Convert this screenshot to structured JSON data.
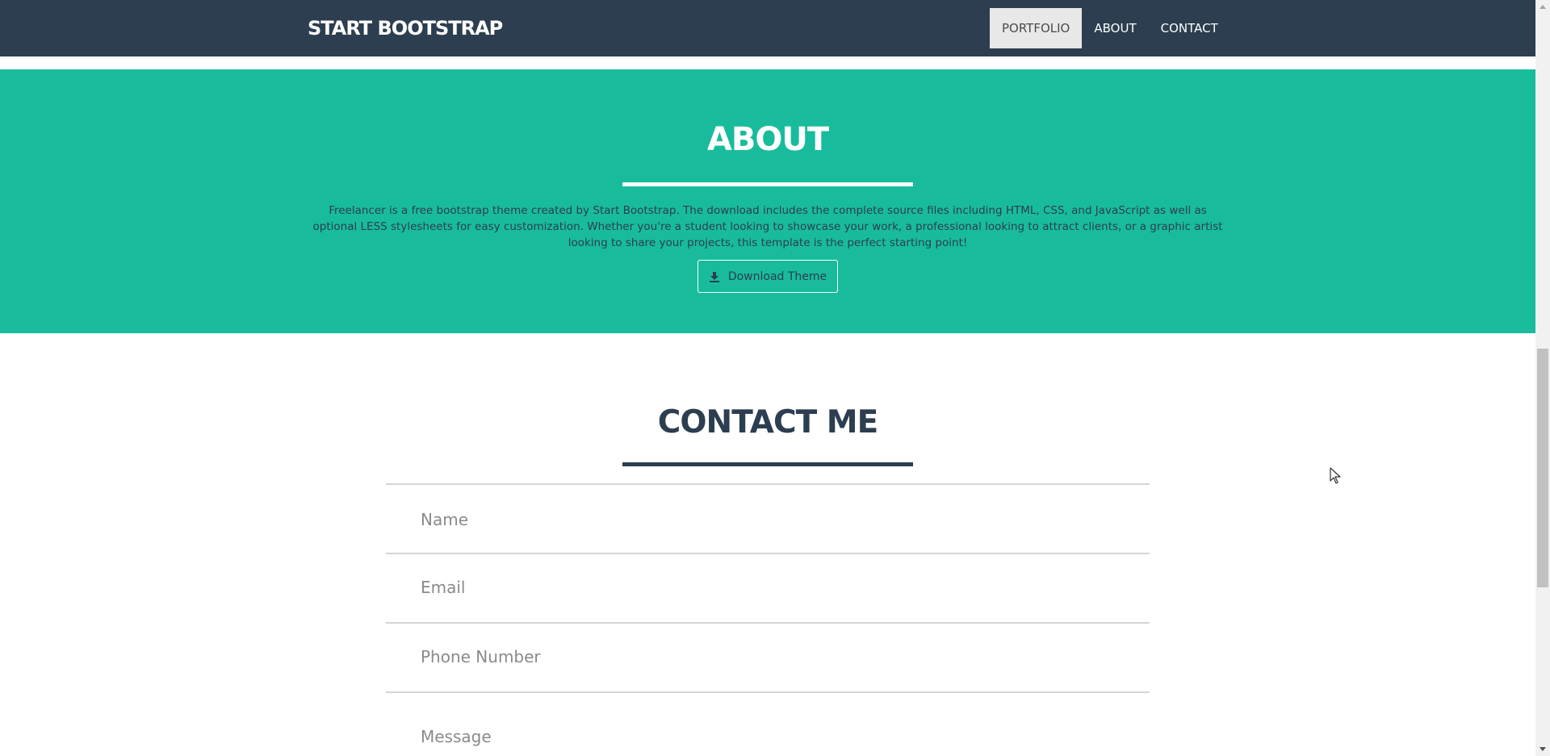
{
  "navbar": {
    "brand": "START BOOTSTRAP",
    "links": [
      {
        "label": "PORTFOLIO",
        "active": true
      },
      {
        "label": "ABOUT",
        "active": false
      },
      {
        "label": "CONTACT",
        "active": false
      }
    ],
    "background_color": "#2c3e50"
  },
  "about": {
    "title": "ABOUT",
    "text": "Freelancer is a free bootstrap theme created by Start Bootstrap. The download includes the complete source files including HTML, CSS, and JavaScript as well as optional LESS stylesheets for easy customization. Whether you're a student looking to showcase your work, a professional looking to attract clients, or a graphic artist looking to share your projects, this template is the perfect starting point!",
    "button_label": "Download Theme",
    "button_icon": "download-icon",
    "background_color": "#18bc9c"
  },
  "contact": {
    "title": "CONTACT ME",
    "fields": {
      "name_placeholder": "Name",
      "email_placeholder": "Email",
      "phone_placeholder": "Phone Number",
      "message_placeholder": "Message"
    }
  }
}
